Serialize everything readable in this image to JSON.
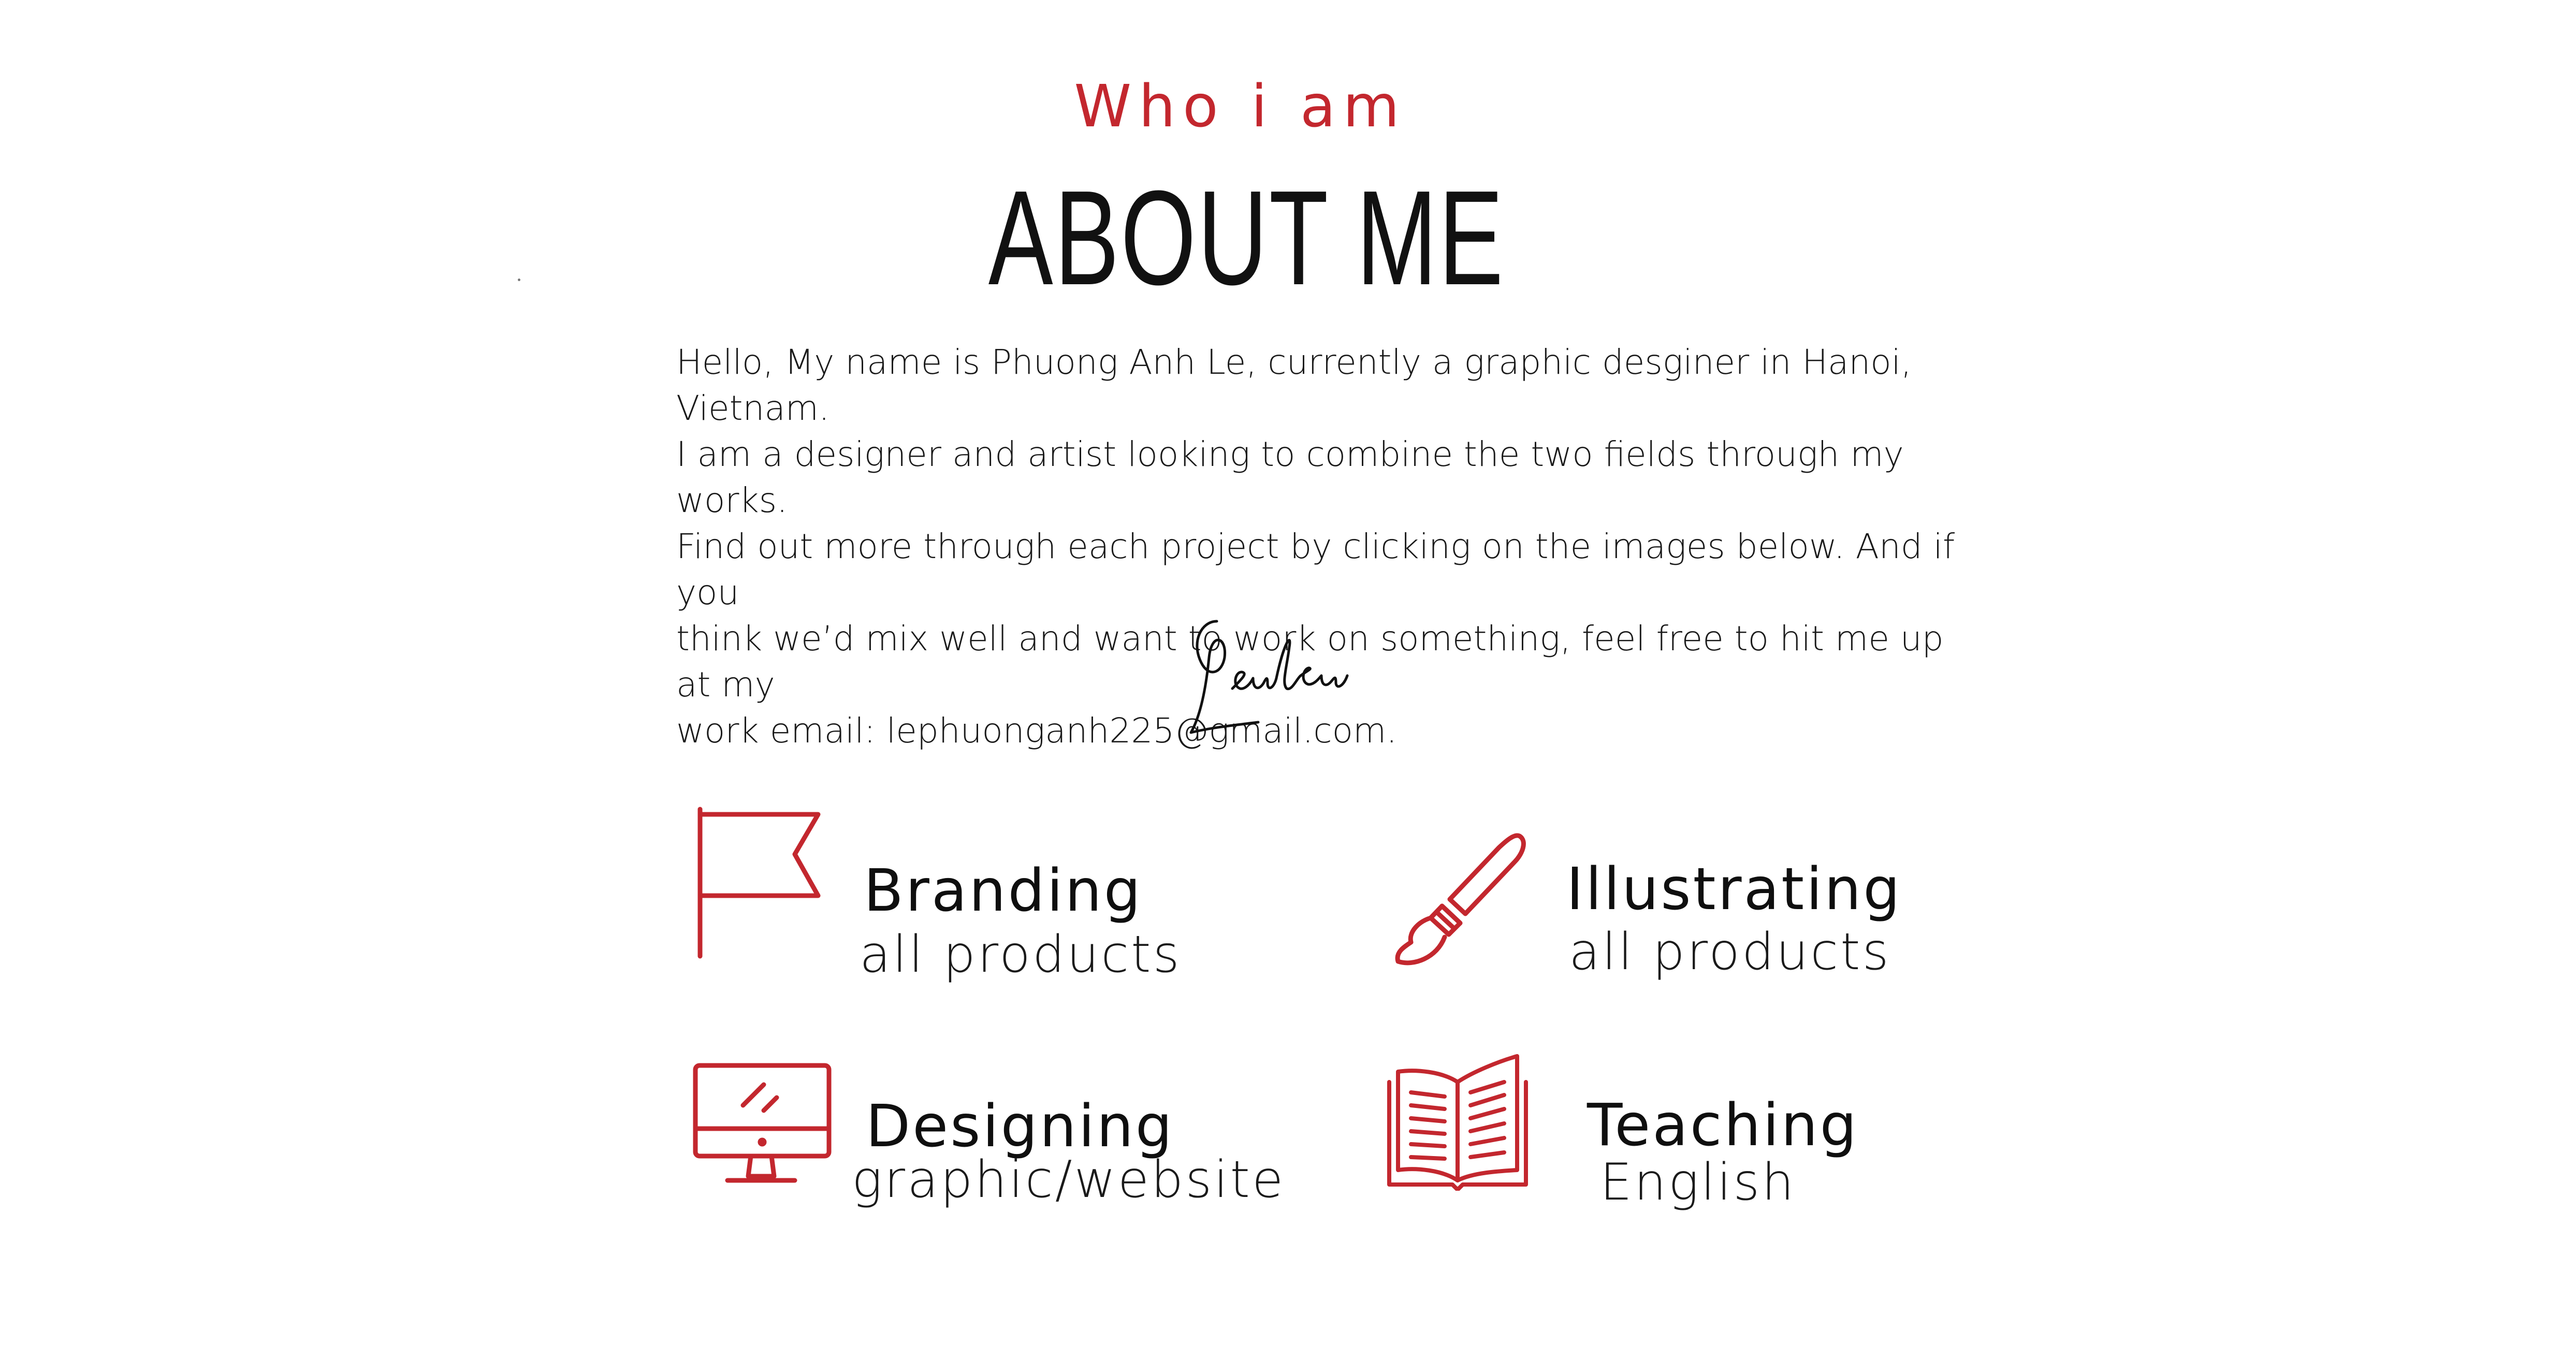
{
  "header": {
    "subtitle": "Who i am",
    "title": "ABOUT ME"
  },
  "bio": {
    "lines": [
      "Hello, My name is Phuong Anh Le, currently a graphic desginer in Hanoi, Vietnam.",
      "I am a designer and artist looking to combine the two fields through my works.",
      "Find out more through each project by clicking on the images below. And if you",
      "think we’d mix well and want to work on something, feel free to hit me up at my",
      "work email: lephuonganh225@gmail.com."
    ]
  },
  "signature": {
    "text": "Leulew"
  },
  "services": [
    {
      "title": "Branding",
      "subtitle": "all products",
      "icon": "flag-icon"
    },
    {
      "title": "Illustrating",
      "subtitle": "all products",
      "icon": "paintbrush-icon"
    },
    {
      "title": "Designing",
      "subtitle": "graphic/website",
      "icon": "monitor-icon"
    },
    {
      "title": "Teaching",
      "subtitle": "English",
      "icon": "open-book-icon"
    }
  ],
  "colors": {
    "accent": "#c3272e",
    "text": "#141414",
    "background": "#ffffff"
  }
}
